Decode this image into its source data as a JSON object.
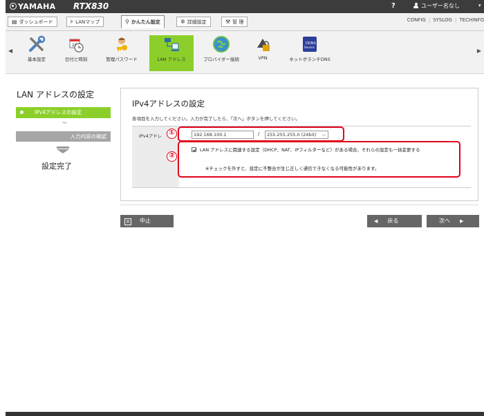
{
  "header": {
    "brand": "YAMAHA",
    "model": "RTX830",
    "help": "?",
    "user": "ユーザー名なし",
    "user_caret": "▾"
  },
  "tabs": [
    {
      "label": "ダッシュボード",
      "icon": "dashboard-icon"
    },
    {
      "label": "LANマップ",
      "icon": "lan-map-icon"
    },
    {
      "label": "かんたん設定",
      "icon": "wizard-icon",
      "active": true
    },
    {
      "label": "詳細設定",
      "icon": "gear-icon"
    },
    {
      "label": "管 理",
      "icon": "wrench-icon"
    }
  ],
  "top_links": [
    "CONFIG",
    "SYSLOG",
    "TECHINFO"
  ],
  "icon_menu": [
    {
      "label": "基本設定",
      "icon": "tools-icon"
    },
    {
      "label": "日付と時刻",
      "icon": "calendar-icon"
    },
    {
      "label": "管理パスワード",
      "icon": "key-person-icon"
    },
    {
      "label": "LAN アドレス",
      "icon": "lan-network-icon",
      "active": true
    },
    {
      "label": "プロバイダー接続",
      "icon": "globe-icon"
    },
    {
      "label": "VPN",
      "icon": "vpn-lock-icon"
    },
    {
      "label": "ネットボランチDNS",
      "icon": "dns-service-icon"
    }
  ],
  "left_pane": {
    "title": "LAN アドレスの設定",
    "steps": [
      "IPv4アドレスの設定",
      "入力内容の確認"
    ],
    "done": "設定完了"
  },
  "form": {
    "title": "IPv4アドレスの設定",
    "description": "各項目を入力してください。入力が完了したら、「次へ」ボタンを押してください。",
    "row_label": "IPv4アドレ",
    "ip_value": "192.168.100.1",
    "slash": "/",
    "mask_value": "255.255.255.0 (24bit)",
    "checkbox_label": "LAN アドレスに関連する設定（DHCP、NAT、IPフィルターなど）がある場合、それらの設定も一括変更する",
    "checkbox_checked": true,
    "note": "※チェックを外すと、設定に不整合が生じ正しく通信できなくなる可能性があります。"
  },
  "annotations": [
    "①",
    "②"
  ],
  "buttons": {
    "cancel": "中止",
    "back": "戻る",
    "next": "次へ"
  },
  "colors": {
    "accent_green": "#8ccf2a",
    "annotation_red": "#e0001a",
    "topbar": "#3c3c3c"
  }
}
